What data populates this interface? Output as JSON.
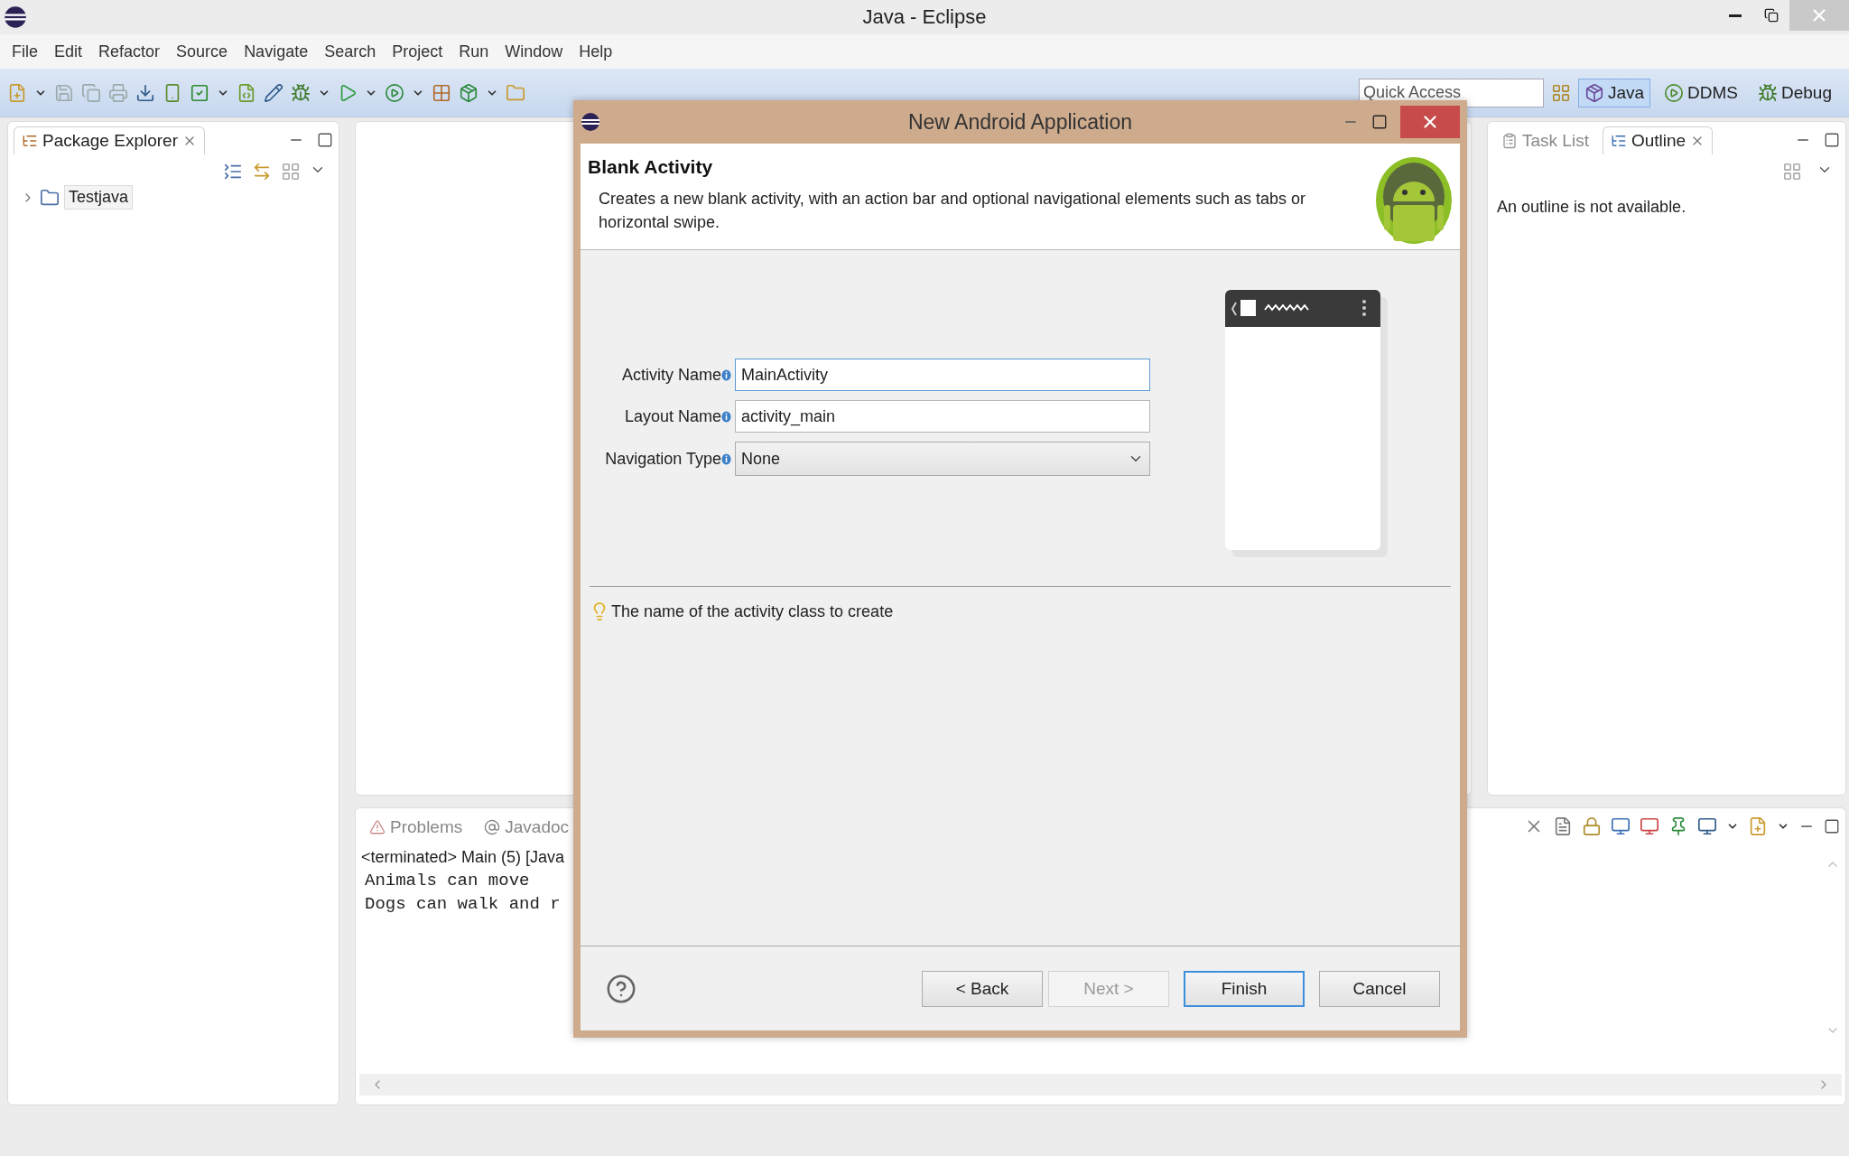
{
  "window": {
    "title": "Java - Eclipse"
  },
  "menu": [
    "File",
    "Edit",
    "Refactor",
    "Source",
    "Navigate",
    "Search",
    "Project",
    "Run",
    "Window",
    "Help"
  ],
  "quick_access": {
    "placeholder": "Quick Access"
  },
  "perspectives": [
    {
      "label": "Java",
      "selected": true
    },
    {
      "label": "DDMS",
      "selected": false
    },
    {
      "label": "Debug",
      "selected": false
    }
  ],
  "package_explorer": {
    "title": "Package Explorer",
    "tree": [
      {
        "label": "Testjava",
        "expanded": false,
        "selected": true
      }
    ]
  },
  "outline": {
    "tabs": [
      {
        "label": "Task List",
        "selected": false
      },
      {
        "label": "Outline",
        "selected": true
      }
    ],
    "message": "An outline is not available."
  },
  "console": {
    "tabs": [
      {
        "label": "Problems",
        "kind": "problems"
      },
      {
        "label": "Javadoc",
        "kind": "javadoc"
      }
    ],
    "header": "<terminated> Main (5) [Java",
    "lines": [
      "Animals can move",
      "Dogs can walk and r"
    ]
  },
  "dialog": {
    "title": "New Android Application",
    "heading": "Blank Activity",
    "description": "Creates a new blank activity, with an action bar and optional navigational elements such as tabs or horizontal swipe.",
    "fields": [
      {
        "label": "Activity Name",
        "value": "MainActivity",
        "kind": "text",
        "focused": true
      },
      {
        "label": "Layout Name",
        "value": "activity_main",
        "kind": "text",
        "focused": false
      },
      {
        "label": "Navigation Type",
        "value": "None",
        "kind": "select",
        "focused": false
      }
    ],
    "hint": "The name of the activity class to create",
    "buttons": [
      {
        "label": "< Back",
        "disabled": false,
        "default": false
      },
      {
        "label": "Next >",
        "disabled": true,
        "default": false
      },
      {
        "label": "Finish",
        "disabled": false,
        "default": true
      },
      {
        "label": "Cancel",
        "disabled": false,
        "default": false
      }
    ]
  }
}
